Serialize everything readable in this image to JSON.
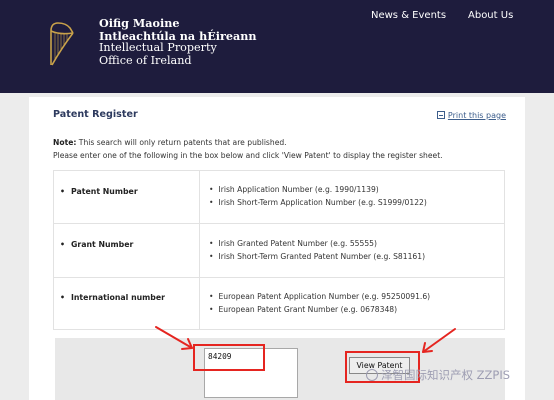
{
  "header": {
    "org_lines": [
      "Oifig Maoine",
      "Intleachtúla na hÉireann",
      "Intellectual Property",
      "Office of Ireland"
    ],
    "nav": [
      {
        "label": "News & Events"
      },
      {
        "label": "About Us"
      }
    ],
    "logo_icon": "harp-icon"
  },
  "page": {
    "title": "Patent Register",
    "print_label": "Print this page",
    "note_bold": "Note:",
    "note_text": " This search will only return patents that are published.",
    "instruction": "Please enter one of the following in the box below and click 'View Patent' to display the register sheet."
  },
  "table": [
    {
      "label": "Patent Number",
      "items": [
        "Irish Application Number (e.g. 1990/1139)",
        "Irish Short-Term Application Number (e.g. S1999/0122)"
      ]
    },
    {
      "label": "Grant Number",
      "items": [
        "Irish Granted Patent Number (e.g. 55555)",
        "Irish Short-Term Granted Patent Number (e.g. S81161)"
      ]
    },
    {
      "label": "International number",
      "items": [
        "European Patent Application Number (e.g. 95250091.6)",
        "European Patent Grant Number (e.g. 0678348)"
      ]
    }
  ],
  "form": {
    "input_value": "84209",
    "button_label": "View Patent"
  },
  "watermark": "泽智国际知识产权 ZZPIS",
  "colors": {
    "header_bg": "#1e1c3d",
    "annotation": "#e52520",
    "page_bg": "#ececec"
  }
}
